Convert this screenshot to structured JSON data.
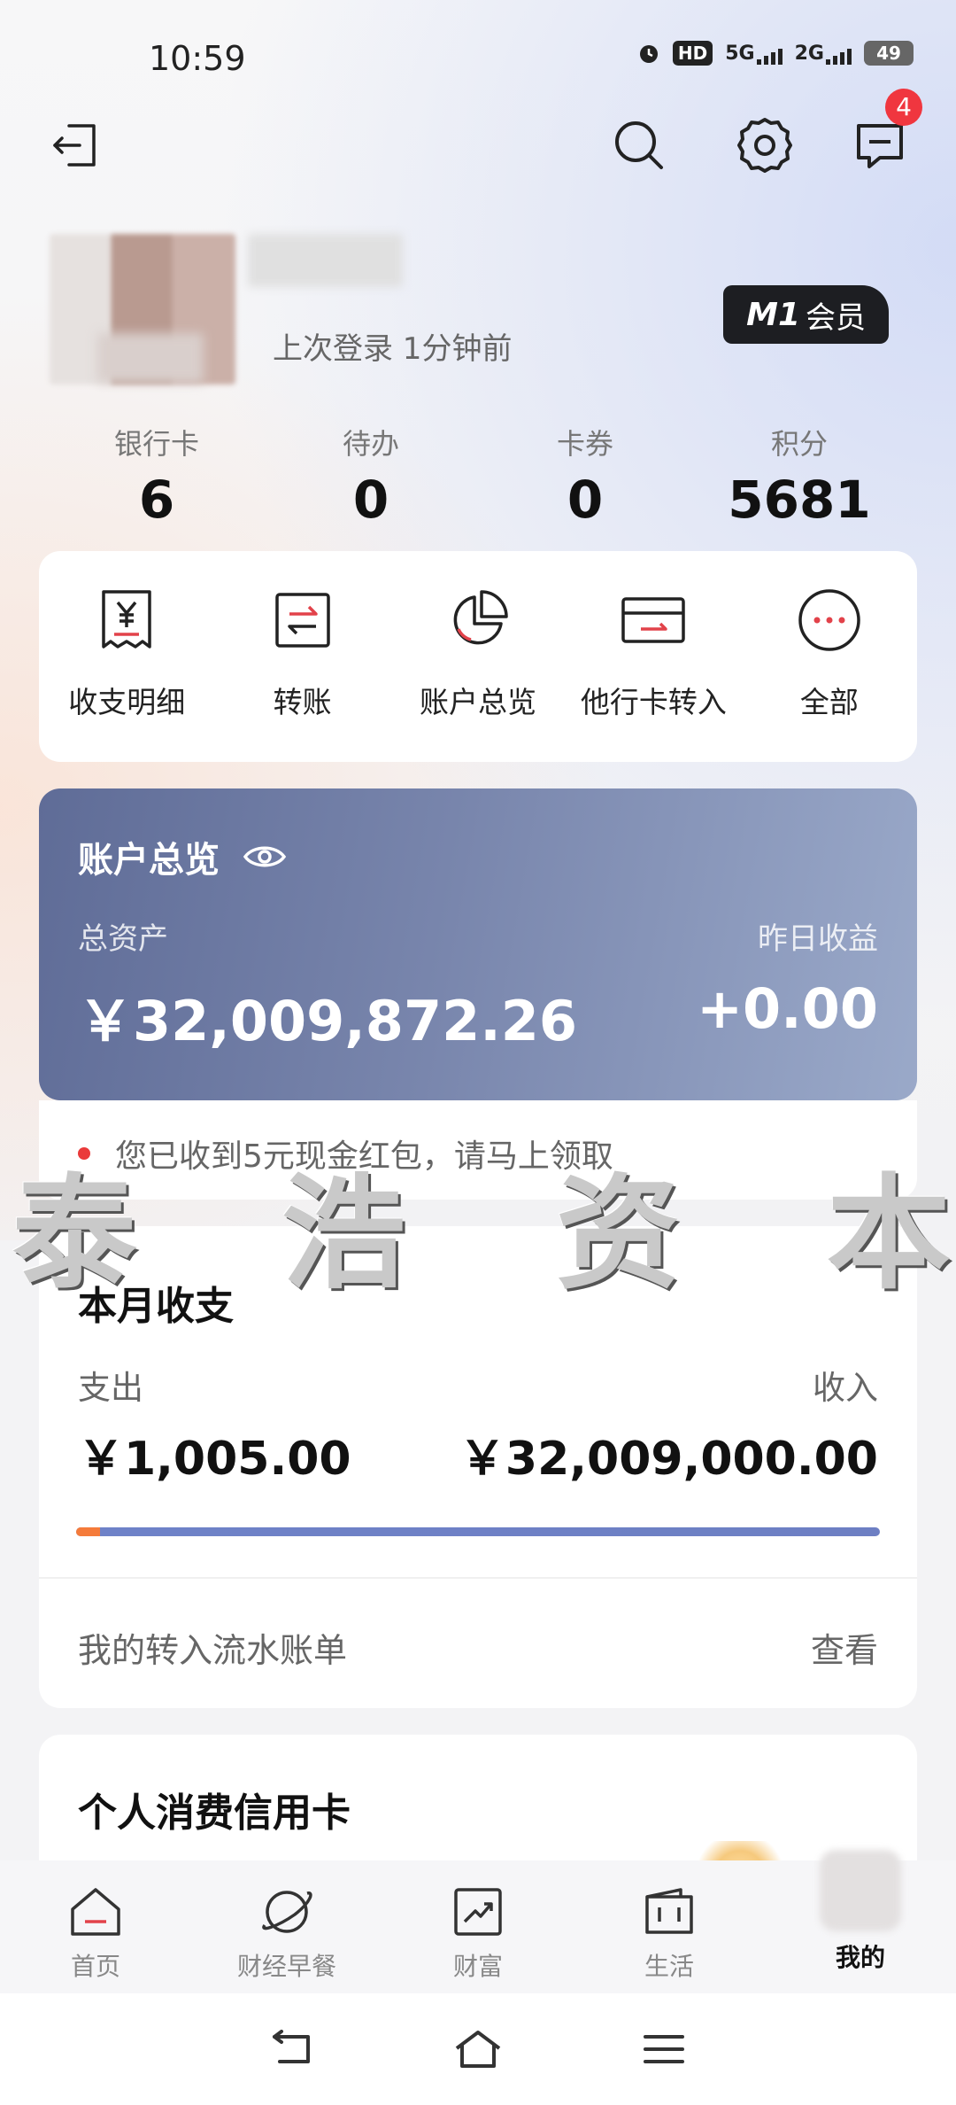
{
  "status": {
    "time": "10:59",
    "hd_label": "HD",
    "net1": "5G",
    "net2": "2G",
    "battery": "49"
  },
  "header": {
    "back_icon": "exit-icon",
    "search_icon": "search-icon",
    "settings_icon": "gear-icon",
    "message_icon": "message-icon",
    "message_badge": "4"
  },
  "profile": {
    "last_login": "上次登录 1分钟前",
    "member_tier": "M1",
    "member_label": "会员"
  },
  "stats": [
    {
      "label": "银行卡",
      "value": "6"
    },
    {
      "label": "待办",
      "value": "0"
    },
    {
      "label": "卡券",
      "value": "0"
    },
    {
      "label": "积分",
      "value": "5681"
    }
  ],
  "shortcuts": [
    {
      "label": "收支明细",
      "icon": "receipt-icon"
    },
    {
      "label": "转账",
      "icon": "transfer-icon"
    },
    {
      "label": "账户总览",
      "icon": "pie-chart-icon"
    },
    {
      "label": "他行卡转入",
      "icon": "card-icon"
    },
    {
      "label": "全部",
      "icon": "more-icon"
    }
  ],
  "overview": {
    "title": "账户总览",
    "total_label": "总资产",
    "total_value": "￥32,009,872.26",
    "yesterday_label": "昨日收益",
    "yesterday_value": "+0.00"
  },
  "notice": {
    "text": "您已收到5元现金红包，请马上领取"
  },
  "watermark": [
    "泰",
    "浩",
    "资",
    "本"
  ],
  "month": {
    "title": "本月收支",
    "expense_label": "支出",
    "expense_value": "￥1,005.00",
    "income_label": "收入",
    "income_value": "￥32,009,000.00",
    "expense_share": 0.03,
    "flow_label": "我的转入流水账单",
    "flow_link": "查看"
  },
  "credit": {
    "title": "个人消费信用卡"
  },
  "tabs": [
    {
      "label": "首页",
      "icon": "home-icon"
    },
    {
      "label": "财经早餐",
      "icon": "planet-icon"
    },
    {
      "label": "财富",
      "icon": "trend-chart-icon"
    },
    {
      "label": "生活",
      "icon": "wallet-icon"
    },
    {
      "label": "我的",
      "icon": "avatar",
      "active": true
    }
  ],
  "colors": {
    "accent_red": "#f0363f",
    "overview_start": "#5f6c97",
    "overview_end": "#9aa9c9",
    "expense_bar": "#f57b3a",
    "income_bar": "#6e82c8"
  }
}
